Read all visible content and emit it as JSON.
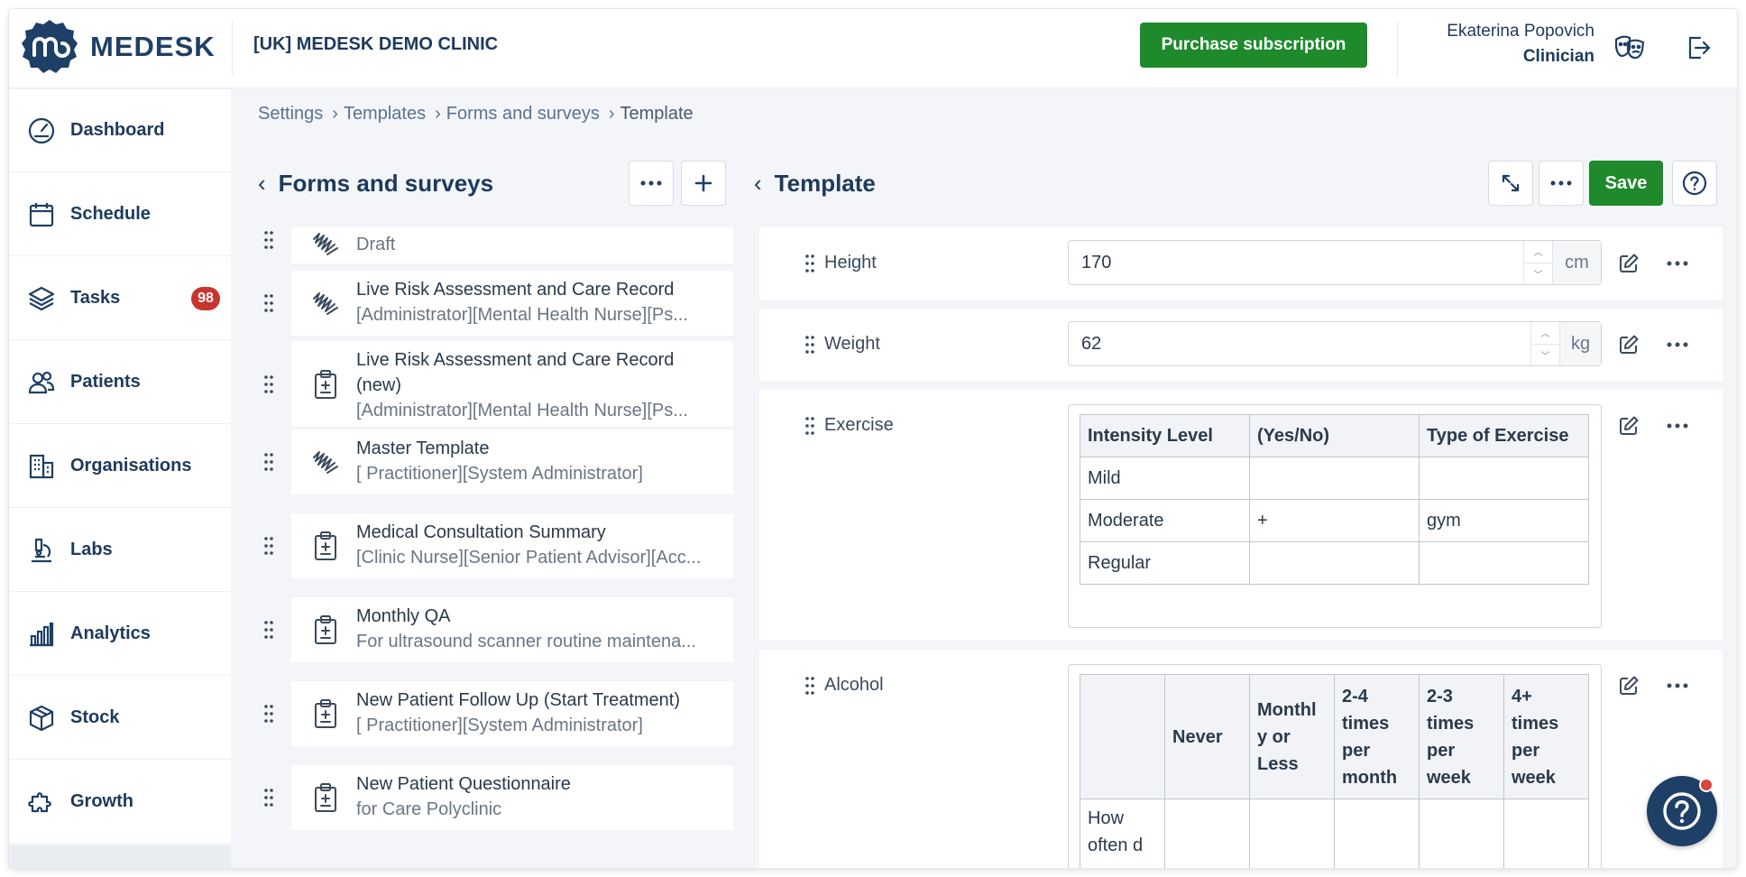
{
  "brand": {
    "name": "MEDESK",
    "clinic": "[UK] MEDESK DEMO CLINIC"
  },
  "header": {
    "purchase_label": "Purchase subscription",
    "user_name": "Ekaterina Popovich",
    "user_role": "Clinician"
  },
  "sidebar": {
    "items": [
      {
        "label": "Dashboard",
        "icon": "dashboard-icon"
      },
      {
        "label": "Schedule",
        "icon": "calendar-icon"
      },
      {
        "label": "Tasks",
        "icon": "layers-icon",
        "count": "98"
      },
      {
        "label": "Patients",
        "icon": "users-icon"
      },
      {
        "label": "Organisations",
        "icon": "building-icon"
      },
      {
        "label": "Labs",
        "icon": "microscope-icon"
      },
      {
        "label": "Analytics",
        "icon": "bar-chart-icon"
      },
      {
        "label": "Stock",
        "icon": "box-icon"
      },
      {
        "label": "Growth",
        "icon": "puzzle-icon"
      }
    ]
  },
  "breadcrumb": [
    "Settings",
    "Templates",
    "Forms and surveys",
    "Template"
  ],
  "left_panel": {
    "title": "Forms and surveys",
    "items": [
      {
        "title": "",
        "subtitle": "Draft",
        "icon": "signature-icon"
      },
      {
        "title": "Live Risk Assessment and Care Record",
        "subtitle": "[Administrator][Mental Health Nurse][Ps...",
        "icon": "signature-icon"
      },
      {
        "title": "Live Risk Assessment and Care Record",
        "title2": "(new)",
        "subtitle": "[Administrator][Mental Health Nurse][Ps...",
        "icon": "clipboard-icon"
      },
      {
        "title": "Master Template",
        "subtitle": "[ Practitioner][System Administrator]",
        "icon": "signature-icon"
      },
      {
        "title": "Medical Consultation Summary",
        "subtitle": "[Clinic Nurse][Senior Patient Advisor][Acc...",
        "icon": "clipboard-icon"
      },
      {
        "title": "Monthly QA",
        "subtitle": "For ultrasound scanner routine maintena...",
        "icon": "clipboard-icon"
      },
      {
        "title": "New Patient Follow Up (Start Treatment)",
        "subtitle": "[ Practitioner][System Administrator]",
        "icon": "clipboard-icon"
      },
      {
        "title": "New Patient Questionnaire",
        "subtitle": "for Care Polyclinic",
        "icon": "clipboard-icon"
      }
    ]
  },
  "right_panel": {
    "title": "Template",
    "save_label": "Save",
    "fields": {
      "height": {
        "label": "Height",
        "value": "170",
        "unit": "cm"
      },
      "weight": {
        "label": "Weight",
        "value": "62",
        "unit": "kg"
      },
      "exercise": {
        "label": "Exercise",
        "headers": [
          "Intensity Level",
          "(Yes/No)",
          "Type of Exercise"
        ],
        "rows": [
          [
            "Mild",
            "",
            ""
          ],
          [
            "Moderate",
            "+",
            "gym"
          ],
          [
            "Regular",
            "",
            ""
          ]
        ]
      },
      "alcohol": {
        "label": "Alcohol",
        "headers": [
          "",
          "Never",
          "Monthl y or Less",
          "2-4 times per month",
          "2-3 times per week",
          "4+ times per week"
        ],
        "first_cell": "How often d"
      }
    }
  },
  "colors": {
    "brand": "#1e3f66",
    "primary_green": "#1e8a2c",
    "badge_red": "#c8342e"
  }
}
